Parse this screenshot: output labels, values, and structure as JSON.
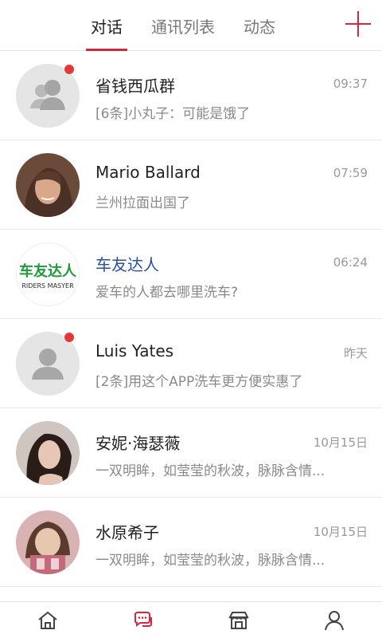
{
  "header": {
    "tabs": [
      {
        "label": "对话",
        "active": true
      },
      {
        "label": "通讯列表",
        "active": false
      },
      {
        "label": "动态",
        "active": false
      }
    ],
    "add_icon": "plus-icon",
    "accent_color": "#e0253a"
  },
  "conversations": [
    {
      "name": "省钱西瓜群",
      "time": "09:37",
      "message": "[6条]小丸子：可能是饿了",
      "avatar": "group-placeholder",
      "unread": true
    },
    {
      "name": "Mario Ballard",
      "time": "07:59",
      "message": "兰州拉面出国了",
      "avatar": "photo",
      "unread": false
    },
    {
      "name": "车友达人",
      "time": "06:24",
      "message": "爱车的人都去哪里洗车?",
      "avatar": "brand-logo",
      "unread": false,
      "brand": true,
      "logo_text": "车友达人",
      "logo_subtext": "RIDERS MASYER"
    },
    {
      "name": "Luis Yates",
      "time": "昨天",
      "message": "[2条]用这个APP洗车更方便实惠了",
      "avatar": "person-placeholder",
      "unread": true
    },
    {
      "name": "安妮·海瑟薇",
      "time": "10月15日",
      "message": "一双明眸，如莹莹的秋波，脉脉含情...",
      "avatar": "photo",
      "unread": false
    },
    {
      "name": "水原希子",
      "time": "10月15日",
      "message": "一双明眸，如莹莹的秋波，脉脉含情...",
      "avatar": "photo",
      "unread": false
    }
  ],
  "bottom_nav": [
    {
      "icon": "home-icon",
      "active": false
    },
    {
      "icon": "chat-icon",
      "active": true
    },
    {
      "icon": "store-icon",
      "active": false
    },
    {
      "icon": "user-icon",
      "active": false
    }
  ]
}
